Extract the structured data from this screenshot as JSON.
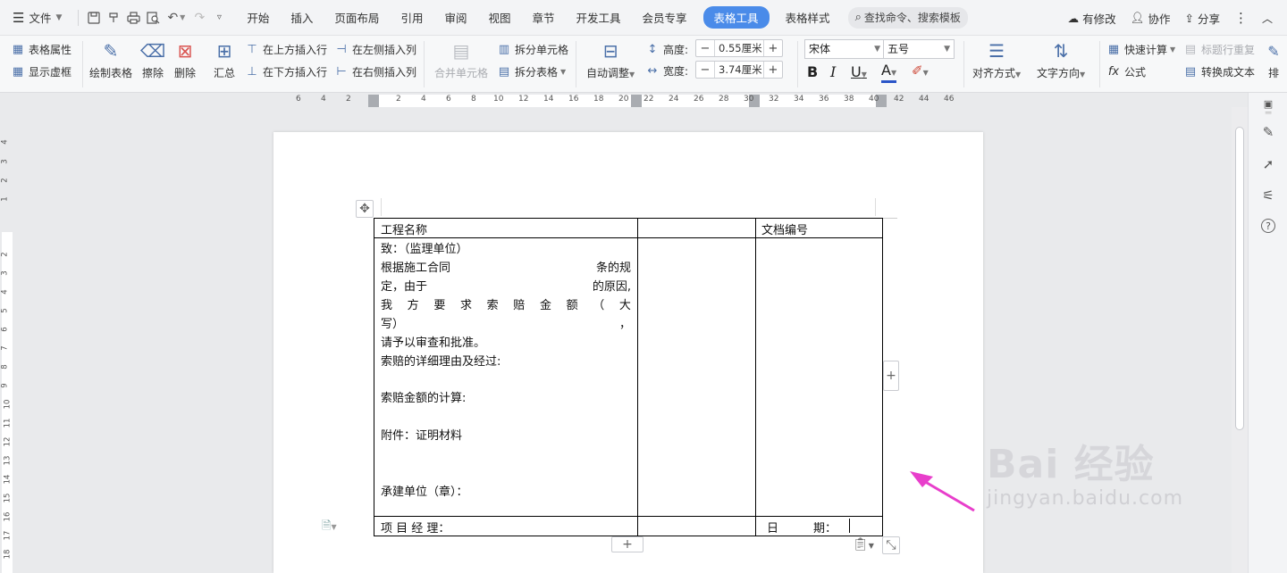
{
  "menubar": {
    "file_label": "文件",
    "tabs": [
      "开始",
      "插入",
      "页面布局",
      "引用",
      "审阅",
      "视图",
      "章节",
      "开发工具",
      "会员专享"
    ],
    "active_tab": "表格工具",
    "secondary_tab": "表格样式",
    "search_label": "查找命令、搜索模板",
    "status_label": "有修改",
    "collab_label": "协作",
    "share_label": "分享"
  },
  "ribbon": {
    "table_props": "表格属性",
    "show_gridlines": "显示虚框",
    "draw_table": "绘制表格",
    "erase": "擦除",
    "delete": "删除",
    "summary": "汇总",
    "insert_row_above": "在上方插入行",
    "insert_row_below": "在下方插入行",
    "insert_col_left": "在左侧插入列",
    "insert_col_right": "在右侧插入列",
    "merge_cells": "合并单元格",
    "split_cells": "拆分单元格",
    "split_table": "拆分表格",
    "auto_fit": "自动调整",
    "height_label": "高度:",
    "height_value": "0.55厘米",
    "width_label": "宽度:",
    "width_value": "3.74厘米",
    "font_name": "宋体",
    "font_size": "五号",
    "align": "对齐方式",
    "text_direction": "文字方向",
    "quick_calc": "快速计算",
    "header_repeat": "标题行重复",
    "formula": "公式",
    "convert_to_text": "转换成文本",
    "sort_partial": "排"
  },
  "ruler": {
    "h_ticks": [
      "6",
      "4",
      "2",
      "2",
      "4",
      "6",
      "8",
      "10",
      "12",
      "14",
      "16",
      "18",
      "20",
      "22",
      "24",
      "26",
      "28",
      "30",
      "32",
      "34",
      "36",
      "38",
      "40",
      "42",
      "44",
      "46"
    ],
    "v_ticks": [
      "4",
      "3",
      "2",
      "1",
      "2",
      "3",
      "4",
      "5",
      "6",
      "7",
      "8",
      "9",
      "10",
      "11",
      "12",
      "13",
      "14",
      "15",
      "16",
      "17",
      "18"
    ]
  },
  "table": {
    "project_name": "工程名称",
    "doc_number": "文档编号",
    "to_line": "致：（监理单位）",
    "line1_a": "根据施工合同",
    "line1_b": "条的规",
    "line2_a": "定，由于",
    "line2_b": "的原因,",
    "line3_chars": [
      "我",
      "方",
      "要",
      "求",
      "索",
      "赔",
      "金",
      "额",
      "（",
      "大"
    ],
    "line4_a": "写）",
    "line4_b": "，",
    "line5": "请予以审查和批准。",
    "line6": "索赔的详细理由及经过:",
    "line7": "索赔金额的计算:",
    "line8": "附件：证明材料",
    "line9": "承建单位（章）：",
    "manager": "项 目 经 理：",
    "date": "日　　　期："
  },
  "watermark": {
    "logo": "Bai 经验",
    "url": "jingyan.baidu.com"
  },
  "colors": {
    "accent": "#4a8be9",
    "annotation_arrow": "#e83ecb"
  }
}
